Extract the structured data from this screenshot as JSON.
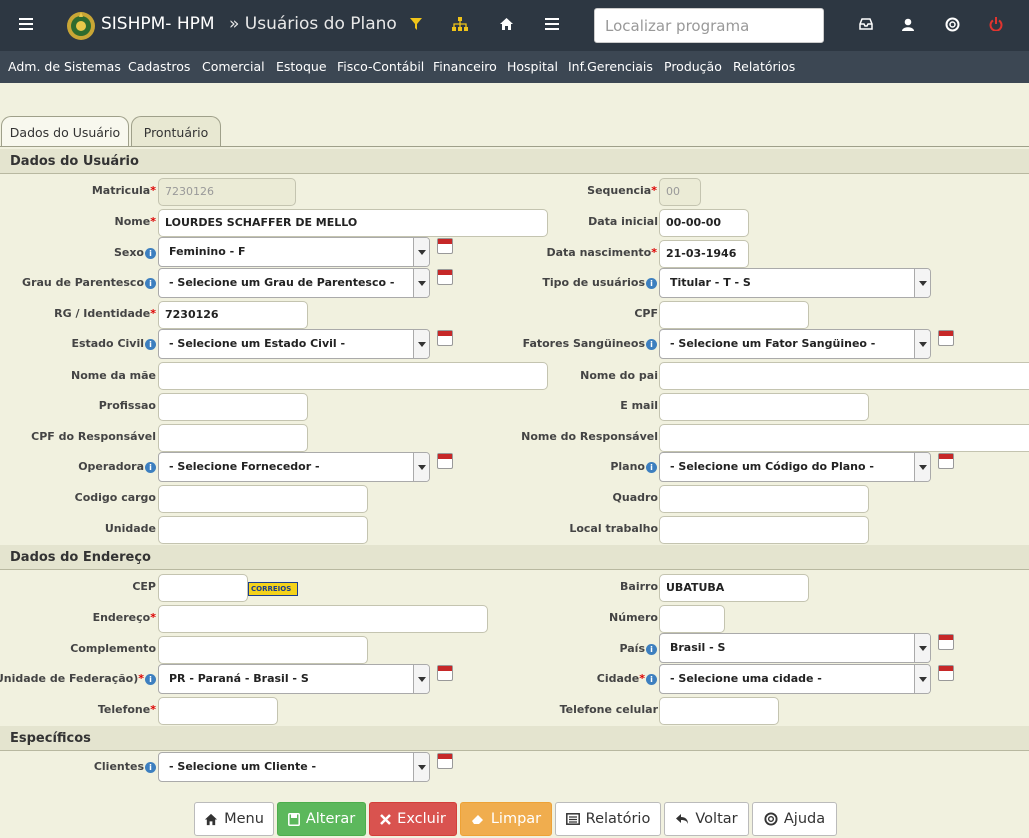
{
  "header": {
    "app_title": "SISHPM- HPM",
    "page_title": "» Usuários do Plano",
    "search_placeholder": "Localizar programa"
  },
  "menu": [
    "Adm. de Sistemas",
    "Cadastros",
    "Comercial",
    "Estoque",
    "Fisco-Contábil",
    "Financeiro",
    "Hospital",
    "Inf.Gerenciais",
    "Produção",
    "Relatórios"
  ],
  "tabs": [
    "Dados do Usuário",
    "Prontuário"
  ],
  "sections": {
    "usuario": "Dados do Usuário",
    "endereco": "Dados do Endereço",
    "especificos": "Específicos"
  },
  "fields": {
    "matricula": {
      "label": "Matricula",
      "value": "7230126"
    },
    "sequencia": {
      "label": "Sequencia",
      "value": "00"
    },
    "nome": {
      "label": "Nome",
      "value": "LOURDES SCHAFFER DE MELLO"
    },
    "data_inicial": {
      "label": "Data inicial",
      "value": "00-00-00"
    },
    "sexo": {
      "label": "Sexo",
      "value": "Feminino - F"
    },
    "data_nascimento": {
      "label": "Data nascimento",
      "value": "21-03-1946"
    },
    "grau_parentesco": {
      "label": "Grau de Parentesco",
      "value": "- Selecione um Grau de Parentesco -"
    },
    "tipo_usuarios": {
      "label": "Tipo de usuários",
      "value": "Titular - T - S"
    },
    "rg": {
      "label": "RG / Identidade",
      "value": "7230126"
    },
    "cpf": {
      "label": "CPF",
      "value": ""
    },
    "estado_civil": {
      "label": "Estado Civil",
      "value": "- Selecione um Estado Civil -"
    },
    "fatores": {
      "label": "Fatores Sangüineos",
      "value": "- Selecione um Fator Sangüineo -"
    },
    "nome_mae": {
      "label": "Nome da mãe",
      "value": ""
    },
    "nome_pai": {
      "label": "Nome do pai",
      "value": ""
    },
    "profissao": {
      "label": "Profissao",
      "value": ""
    },
    "email": {
      "label": "E mail",
      "value": ""
    },
    "cpf_resp": {
      "label": "CPF do Responsável",
      "value": ""
    },
    "nome_resp": {
      "label": "Nome do Responsável",
      "value": ""
    },
    "operadora": {
      "label": "Operadora",
      "value": "- Selecione Fornecedor -"
    },
    "plano": {
      "label": "Plano",
      "value": "- Selecione um Código do Plano -"
    },
    "codigo_cargo": {
      "label": "Codigo cargo",
      "value": ""
    },
    "quadro": {
      "label": "Quadro",
      "value": ""
    },
    "unidade": {
      "label": "Unidade",
      "value": ""
    },
    "local_trabalho": {
      "label": "Local trabalho",
      "value": ""
    },
    "cep": {
      "label": "CEP",
      "value": ""
    },
    "correios": "CORREIOS",
    "bairro": {
      "label": "Bairro",
      "value": "UBATUBA"
    },
    "endereco": {
      "label": "Endereço",
      "value": ""
    },
    "numero": {
      "label": "Número",
      "value": ""
    },
    "complemento": {
      "label": "Complemento",
      "value": ""
    },
    "pais": {
      "label": "País",
      "value": "Brasil - S"
    },
    "uf": {
      "label": "UF (Unidade de Federação)",
      "value": "PR - Paraná - Brasil - S"
    },
    "cidade": {
      "label": "Cidade",
      "value": "- Selecione uma cidade -"
    },
    "telefone": {
      "label": "Telefone",
      "value": ""
    },
    "telefone_celular": {
      "label": "Telefone celular",
      "value": ""
    },
    "clientes": {
      "label": "Clientes",
      "value": "- Selecione um Cliente -"
    }
  },
  "buttons": {
    "menu": "Menu",
    "alterar": "Alterar",
    "excluir": "Excluir",
    "limpar": "Limpar",
    "relatorio": "Relatório",
    "voltar": "Voltar",
    "ajuda": "Ajuda"
  },
  "colors": {
    "topbar": "#2d3742",
    "menubar": "#3c4753",
    "background": "#f1f1df",
    "required": "#dd0000",
    "info": "#3d7fbf",
    "btn_green": "#5cb85c",
    "btn_red": "#d9534f",
    "btn_orange": "#f0ad4e"
  }
}
